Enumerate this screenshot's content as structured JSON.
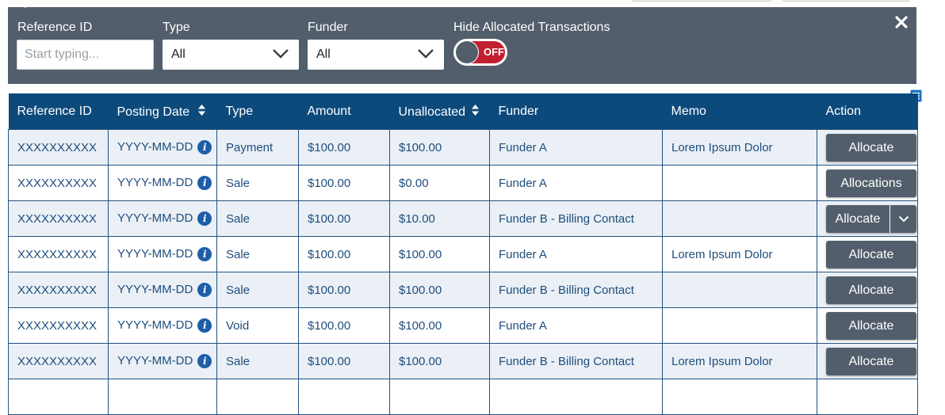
{
  "filters": {
    "reference_id": {
      "label": "Reference ID",
      "placeholder": "Start typing..."
    },
    "type": {
      "label": "Type",
      "value": "All"
    },
    "funder": {
      "label": "Funder",
      "value": "All"
    },
    "hide_allocated": {
      "label": "Hide Allocated Transactions",
      "state": "OFF"
    }
  },
  "table": {
    "headers": {
      "reference_id": "Reference ID",
      "posting_date": "Posting Date",
      "type": "Type",
      "amount": "Amount",
      "unallocated": "Unallocated",
      "funder": "Funder",
      "memo": "Memo",
      "action": "Action"
    },
    "rows": [
      {
        "ref": "XXXXXXXXXX",
        "date": "YYYY-MM-DD",
        "type": "Payment",
        "amount": "$100.00",
        "unallocated": "$100.00",
        "funder": "Funder A",
        "memo": "Lorem Ipsum Dolor",
        "action": "Allocate"
      },
      {
        "ref": "XXXXXXXXXX",
        "date": "YYYY-MM-DD",
        "type": "Sale",
        "amount": "$100.00",
        "unallocated": "$0.00",
        "funder": "Funder A",
        "memo": "",
        "action": "Allocations"
      },
      {
        "ref": "XXXXXXXXXX",
        "date": "YYYY-MM-DD",
        "type": "Sale",
        "amount": "$100.00",
        "unallocated": "$10.00",
        "funder": "Funder B - Billing Contact",
        "memo": "",
        "action": "Allocate"
      },
      {
        "ref": "XXXXXXXXXX",
        "date": "YYYY-MM-DD",
        "type": "Sale",
        "amount": "$100.00",
        "unallocated": "$100.00",
        "funder": "Funder A",
        "memo": "Lorem Ipsum Dolor",
        "action": "Allocate"
      },
      {
        "ref": "XXXXXXXXXX",
        "date": "YYYY-MM-DD",
        "type": "Sale",
        "amount": "$100.00",
        "unallocated": "$100.00",
        "funder": "Funder B - Billing Contact",
        "memo": "",
        "action": "Allocate"
      },
      {
        "ref": "XXXXXXXXXX",
        "date": "YYYY-MM-DD",
        "type": "Void",
        "amount": "$100.00",
        "unallocated": "$100.00",
        "funder": "Funder A",
        "memo": "",
        "action": "Allocate"
      },
      {
        "ref": "XXXXXXXXXX",
        "date": "YYYY-MM-DD",
        "type": "Sale",
        "amount": "$100.00",
        "unallocated": "$100.00",
        "funder": "Funder B - Billing Contact",
        "memo": "Lorem Ipsum Dolor",
        "action": "Allocate"
      }
    ]
  },
  "colors": {
    "filter_bg": "#525e6b",
    "header_bg": "#0d4a7c",
    "toggle_off": "#c01f2f",
    "button_bg": "#525e6b",
    "info_icon": "#1d5ea8"
  },
  "icons": {
    "close": "close-icon",
    "menu": "column-menu-icon",
    "sort": "sort-icon",
    "info": "info-icon",
    "chevron": "chevron-down-icon"
  }
}
